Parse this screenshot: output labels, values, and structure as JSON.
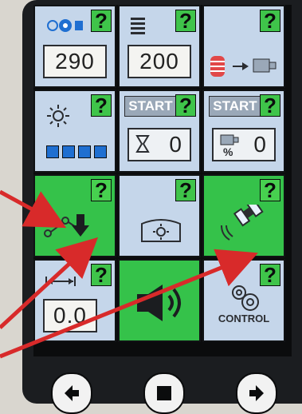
{
  "tiles": {
    "fan_value": "290",
    "layers_value": "200",
    "hourglass_value": "0",
    "motor_percent_value": "0",
    "control_label": "CONTROL",
    "start_label": "START",
    "percent_label": "%",
    "distance_value": "0.0"
  },
  "help_glyph": "?",
  "brightness_level_dots": 4,
  "colors": {
    "tile_blue": "#c5d6ea",
    "tile_green": "#35c24a",
    "help_green": "#47d04f",
    "annotation_red": "#d82a2a"
  },
  "icons": {
    "nav_prev": "left-arrow-icon",
    "nav_stop": "stop-icon",
    "nav_next": "right-arrow-icon"
  }
}
